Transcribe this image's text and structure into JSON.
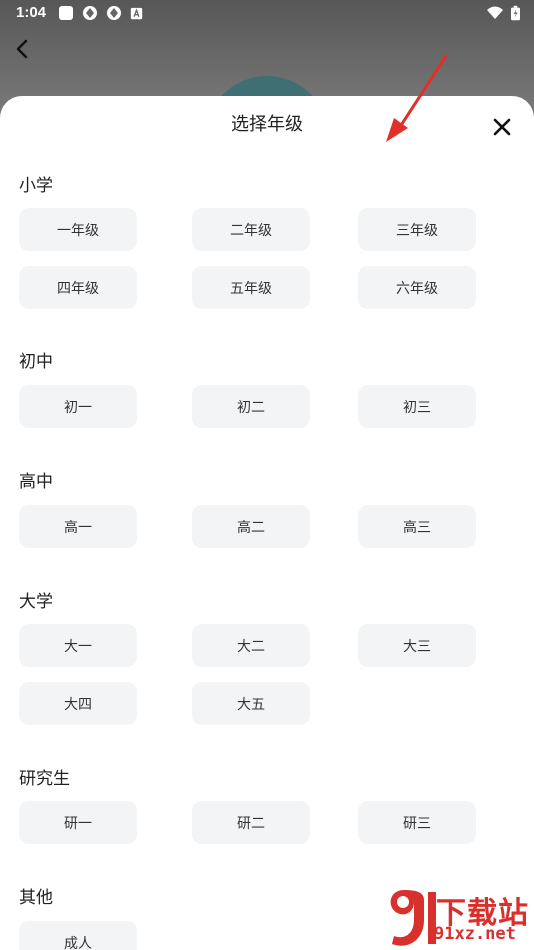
{
  "status_bar": {
    "time": "1:04"
  },
  "sheet": {
    "title": "选择年级",
    "sections": [
      {
        "title": "小学",
        "items": [
          "一年级",
          "二年级",
          "三年级",
          "四年级",
          "五年级",
          "六年级"
        ]
      },
      {
        "title": "初中",
        "items": [
          "初一",
          "初二",
          "初三"
        ]
      },
      {
        "title": "高中",
        "items": [
          "高一",
          "高二",
          "高三"
        ]
      },
      {
        "title": "大学",
        "items": [
          "大一",
          "大二",
          "大三",
          "大四",
          "大五"
        ]
      },
      {
        "title": "研究生",
        "items": [
          "研一",
          "研二",
          "研三"
        ]
      },
      {
        "title": "其他",
        "items": [
          "成人"
        ]
      }
    ]
  },
  "watermark": {
    "title": "下载站",
    "url": "91xz.net"
  },
  "colors": {
    "annotation": "#e0302a",
    "button_bg": "#f3f4f5",
    "watermark": "#d8302c"
  },
  "icons": [
    "back-arrow-icon",
    "close-icon",
    "wifi-icon",
    "battery-icon"
  ]
}
